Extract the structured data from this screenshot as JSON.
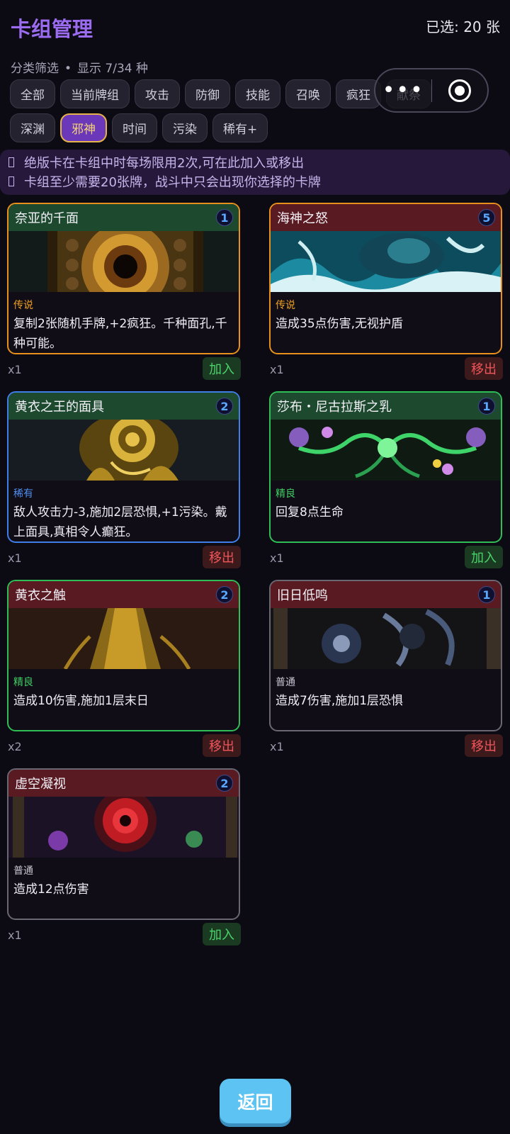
{
  "header": {
    "title": "卡组管理",
    "selected": "已选: 20 张"
  },
  "filter": {
    "label": "分类筛选",
    "dot": "•",
    "shown": "显示 7/34 种"
  },
  "chips_row1": [
    "全部",
    "当前牌组",
    "攻击",
    "防御",
    "技能",
    "召唤",
    "疯狂",
    "献祭"
  ],
  "chips_row2": [
    "深渊",
    "邪神",
    "时间",
    "污染",
    "稀有+"
  ],
  "active_chip": "邪神",
  "notices": [
    "绝版卡在卡组中时每场限用2次,可在此加入或移出",
    "卡组至少需要20张牌，战斗中只会出现你选择的卡牌"
  ],
  "cards": [
    {
      "name": "奈亚的千面",
      "cost": "1",
      "rarity": "传说",
      "desc": "复制2张随机手牌,+2疯狂。千种面孔,千种可能。",
      "count": "x1",
      "action": "加入"
    },
    {
      "name": "海神之怒",
      "cost": "5",
      "rarity": "传说",
      "desc": "造成35点伤害,无视护盾",
      "count": "x1",
      "action": "移出"
    },
    {
      "name": "黄衣之王的面具",
      "cost": "2",
      "rarity": "稀有",
      "desc": "敌人攻击力-3,施加2层恐惧,+1污染。戴上面具,真相令人癫狂。",
      "count": "x1",
      "action": "移出"
    },
    {
      "name": "莎布・尼古拉斯之乳",
      "cost": "1",
      "rarity": "精良",
      "desc": "回复8点生命",
      "count": "x1",
      "action": "加入"
    },
    {
      "name": "黄衣之触",
      "cost": "2",
      "rarity": "精良",
      "desc": "造成10伤害,施加1层末日",
      "count": "x2",
      "action": "移出"
    },
    {
      "name": "旧日低鸣",
      "cost": "1",
      "rarity": "普通",
      "desc": "造成7伤害,施加1层恐惧",
      "count": "x1",
      "action": "移出"
    },
    {
      "name": "虚空凝视",
      "cost": "2",
      "rarity": "普通",
      "desc": "造成12点伤害",
      "count": "x1",
      "action": "加入"
    }
  ],
  "back_label": "返回",
  "colors": {
    "accent_purple": "#9b6cf0",
    "legendary": "#f0a020",
    "rare": "#3f7ee6",
    "fine": "#2fbd55",
    "common": "#6a6672",
    "add_green": "#4bd46a",
    "remove_red": "#f0555a"
  },
  "icons": {
    "capsule_more": "more-dots-icon",
    "capsule_close": "target-circle-icon",
    "notice_bullet": "placeholder-box-icon"
  }
}
